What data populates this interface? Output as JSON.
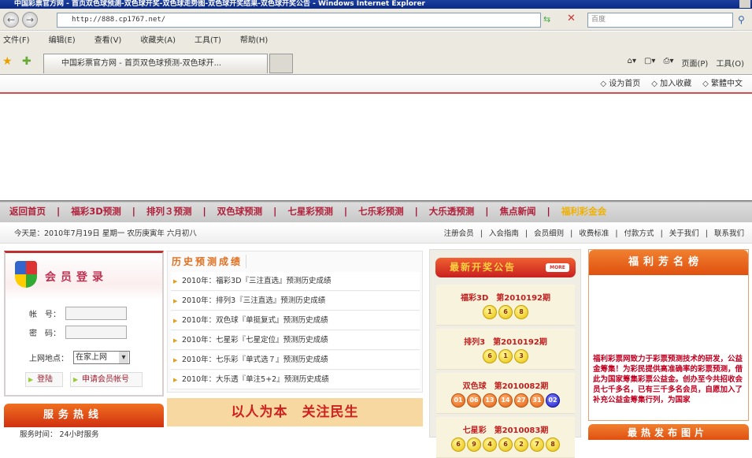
{
  "window": {
    "title": "中国彩票官方网 - 首页双色球预测-双色球开奖-双色球走势图-双色球开奖结果-双色球开奖公告 - Windows Internet Explorer"
  },
  "browser": {
    "url": "http://888.cp1767.net/",
    "search_placeholder": "百度",
    "menu": [
      "文件(F)",
      "编辑(E)",
      "查看(V)",
      "收藏夹(A)",
      "工具(T)",
      "帮助(H)"
    ],
    "tab_title": "中国彩票官方网 - 首页双色球预测-双色球开...",
    "commands": [
      "页面(P)",
      "工具(O)"
    ]
  },
  "top_links": [
    "◇ 设为首页",
    "◇ 加入收藏",
    "◇ 繁體中文"
  ],
  "nav": [
    "返回首页",
    "福彩3D预测",
    "排列３预测",
    "双色球预测",
    "七星彩预测",
    "七乐彩预测",
    "大乐透预测",
    "焦点新闻",
    "福利彩金会"
  ],
  "datebar": {
    "date": "今天是：2010年7月19日 星期一 农历庚寅年 六月初八",
    "links": [
      "注册会员",
      "入会指南",
      "会员细则",
      "收费标准",
      "付款方式",
      "关于我们",
      "联系我们"
    ],
    "sep": "|"
  },
  "login": {
    "title": "会员登录",
    "account_label": "帐　号：",
    "password_label": "密　码：",
    "location_label": "上网地点：",
    "location_value": "在家上网",
    "login_btn": "登陆",
    "register_btn": "申请会员帐号"
  },
  "service": {
    "title": "服务热线",
    "time": "服务时间： 24小时服务"
  },
  "history": {
    "title": "历史预测成绩",
    "items": [
      "2010年：福彩3D『三注直选』预测历史成绩",
      "2010年：排列3『三注直选』预测历史成绩",
      "2010年：双色球『单挺复式』预测历史成绩",
      "2010年：七星彩『七星定位』预测历史成绩",
      "2010年：七乐彩『单式选７』预测历史成绩",
      "2010年：大乐透『单注5+2』预测历史成绩"
    ]
  },
  "slogan": "以人为本　关注民生",
  "lottery": {
    "title": "最新开奖公告",
    "more": "MORE",
    "groups": [
      {
        "name": "福彩3D　第2010192期",
        "balls": [
          "1",
          "6",
          "8"
        ],
        "blue": []
      },
      {
        "name": "排列3　第2010192期",
        "balls": [
          "6",
          "1",
          "3"
        ],
        "blue": []
      },
      {
        "name": "双色球　第2010082期",
        "balls": [
          "01",
          "06",
          "13",
          "14",
          "27",
          "31"
        ],
        "blue": [
          "02"
        ]
      },
      {
        "name": "七星彩　第2010083期",
        "balls": [
          "6",
          "9",
          "4",
          "6",
          "2",
          "7",
          "8"
        ],
        "blue": []
      }
    ]
  },
  "fame": {
    "title": "福利芳名榜",
    "text": "福利彩票网致力于彩票预测技术的研发，公益金筹集！为彩民提供高准确率的彩票预测，借此为国家筹集彩票公益金。创办至今共招收会员七千多名，已有三千多名会员，自愿加入了补充公益金筹集行列，为国家"
  },
  "panel2": {
    "title": "最热发布图片"
  }
}
